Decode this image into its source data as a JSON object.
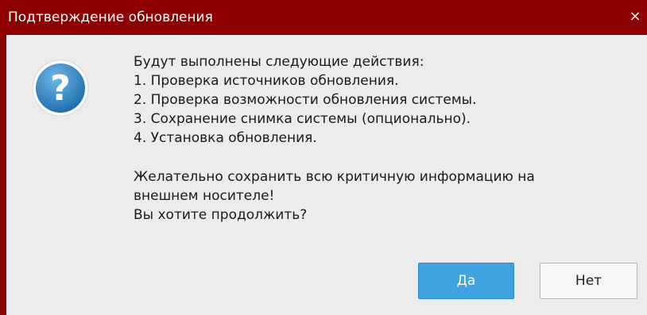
{
  "dialog": {
    "title": "Подтверждение обновления",
    "close_glyph": "×",
    "icon": "question-icon",
    "message_lines": [
      "Будут выполнены следующие действия:",
      "1. Проверка источников обновления.",
      "2. Проверка возможности обновления системы.",
      "3. Сохранение снимка системы (опционально).",
      "4. Установка обновления."
    ],
    "warning_lines": [
      "Желательно сохранить всю критичную информацию на",
      "внешнем носителе!",
      "Вы хотите продолжить?"
    ],
    "buttons": {
      "yes_label": "Да",
      "no_label": "Нет"
    },
    "colors": {
      "titlebar": "#8e0000",
      "body": "#ececec",
      "primary_button": "#3ea3e0",
      "icon_blue": "#2f86c9"
    }
  }
}
